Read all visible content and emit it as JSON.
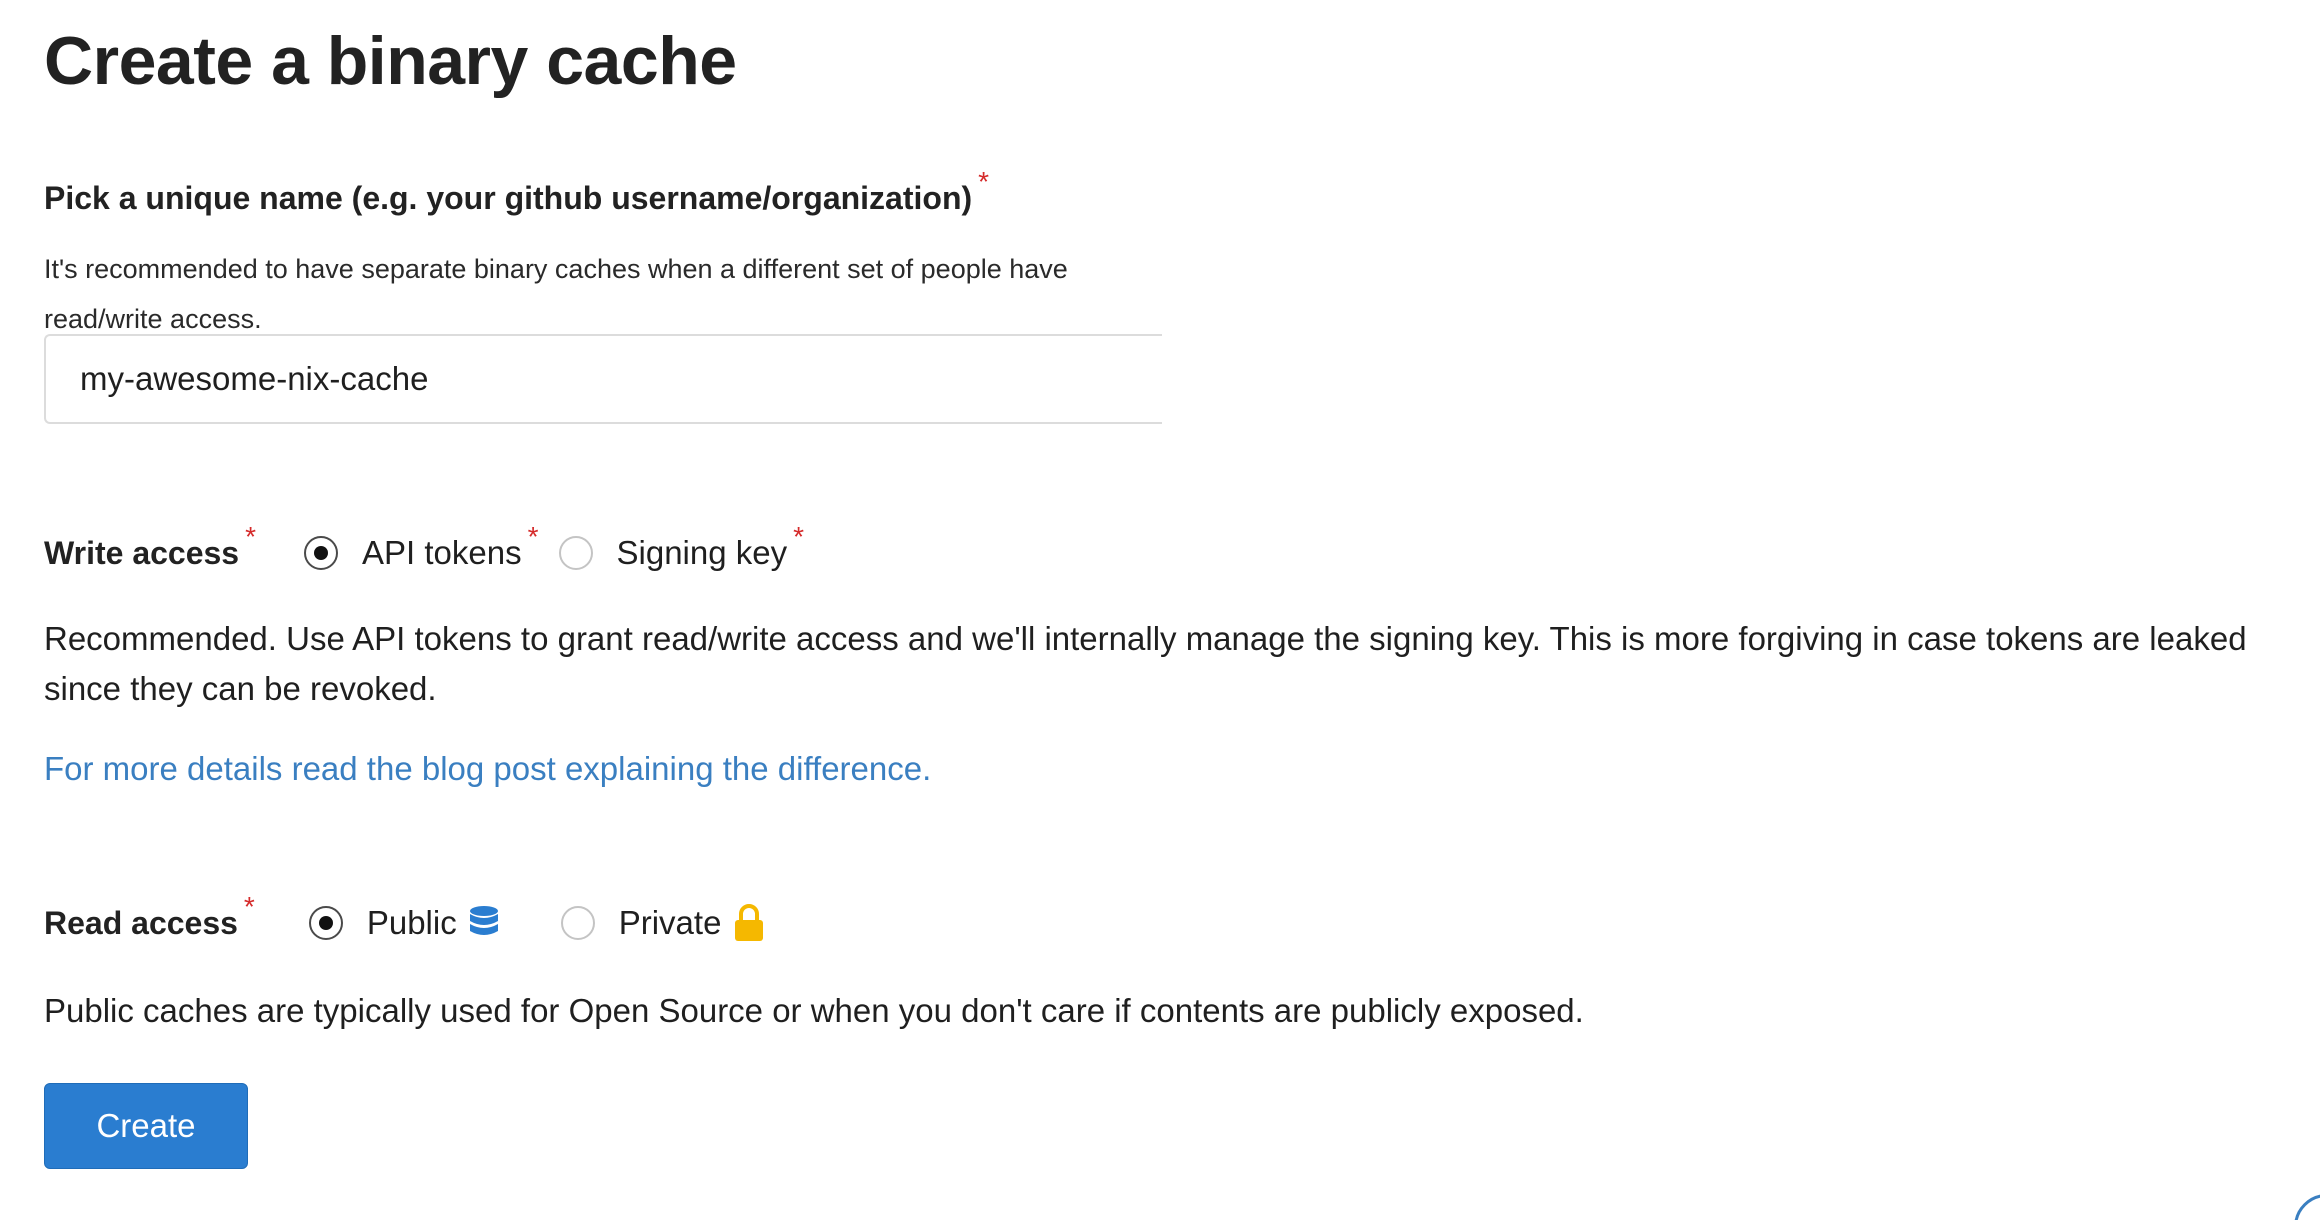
{
  "page": {
    "title": "Create a binary cache"
  },
  "name_field": {
    "label": "Pick a unique name (e.g. your github username/organization)",
    "required_mark": "*",
    "help_text": "It's recommended to have separate binary caches when a different set of people have read/write access.",
    "value": "my-awesome-nix-cache"
  },
  "write_access": {
    "label": "Write access",
    "required_mark": "*",
    "options": [
      {
        "label": "API tokens",
        "required_mark": "*",
        "selected": true
      },
      {
        "label": "Signing key",
        "required_mark": "*",
        "selected": false
      }
    ],
    "description": "Recommended. Use API tokens to grant read/write access and we'll internally manage the signing key. This is more forgiving in case tokens are leaked since they can be revoked.",
    "link_text": "For more details read the blog post explaining the difference."
  },
  "read_access": {
    "label": "Read access",
    "required_mark": "*",
    "options": [
      {
        "label": "Public",
        "icon": "database-icon",
        "selected": true
      },
      {
        "label": "Private",
        "icon": "lock-icon",
        "selected": false
      }
    ],
    "description": "Public caches are typically used for Open Source or when you don't care if contents are publicly exposed."
  },
  "actions": {
    "create_label": "Create"
  },
  "colors": {
    "accent": "#2a7dd0",
    "link": "#3a7fc1",
    "required": "#d52b2b",
    "lock": "#f5b800"
  }
}
